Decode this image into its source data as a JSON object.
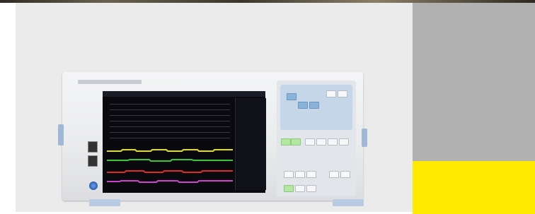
{
  "image": {
    "subject": "power-analyzer-product-photo",
    "colors": {
      "photo_background": "#ebebeb",
      "gray_panel": "#b1b1b1",
      "yellow_panel": "#ffea00",
      "trace_yellow": "#e8e000",
      "trace_green": "#39c839",
      "trace_red": "#e02a2a",
      "trace_magenta": "#d040d0"
    }
  }
}
